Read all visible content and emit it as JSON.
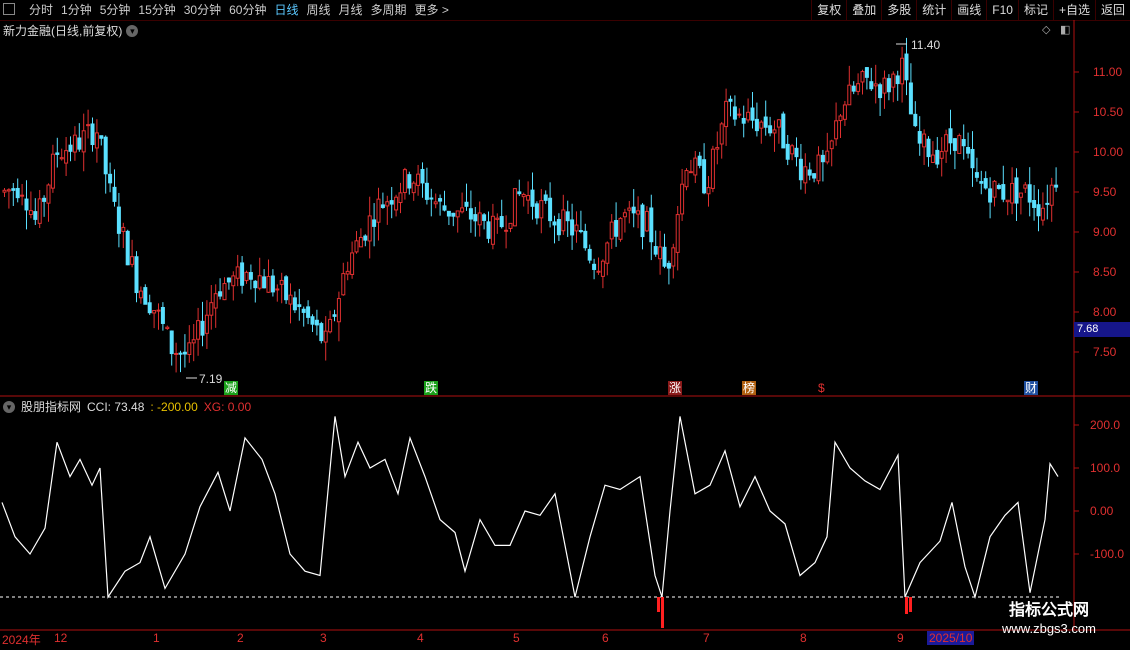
{
  "toolbar": {
    "periods": [
      "分时",
      "1分钟",
      "5分钟",
      "15分钟",
      "30分钟",
      "60分钟",
      "日线",
      "周线",
      "月线",
      "多周期",
      "更多 >"
    ],
    "active_period": "日线",
    "tools": [
      "复权",
      "叠加",
      "多股",
      "统计",
      "画线",
      "F10",
      "标记",
      "+自选",
      "返回"
    ]
  },
  "stock": {
    "title": "新力金融(日线,前复权)"
  },
  "price_axis": {
    "ticks": [
      "11.00",
      "10.50",
      "10.00",
      "9.50",
      "9.00",
      "8.50",
      "8.00",
      "7.50"
    ],
    "current": "7.68"
  },
  "annotations": {
    "high": "11.40",
    "low": "7.19"
  },
  "events": [
    {
      "label": "减",
      "color": "#1aa01a",
      "text": "#fff"
    },
    {
      "label": "跌",
      "color": "#1aa01a",
      "text": "#fff"
    },
    {
      "label": "涨",
      "color": "#8a1a1a",
      "text": "#fff"
    },
    {
      "label": "榜",
      "color": "#b06010",
      "text": "#fff"
    },
    {
      "label": "$",
      "color": "#000",
      "text": "#e03030"
    },
    {
      "label": "财",
      "color": "#2050a0",
      "text": "#fff"
    }
  ],
  "indicator": {
    "name": "股朋指标网",
    "cci": "CCI: 73.48",
    "level": ": -200.00",
    "xg": "XG: 0.00",
    "ticks": [
      "200.0",
      "100.0",
      "0.00",
      "-100.0"
    ]
  },
  "x_axis": {
    "labels": [
      "2024年",
      "12",
      "1",
      "2",
      "3",
      "4",
      "5",
      "6",
      "7",
      "8",
      "9",
      "2025/10"
    ]
  },
  "watermark": {
    "line1": "指标公式网",
    "line2": "www.zbgs3.com"
  },
  "colors": {
    "up": "#e03030",
    "down": "#5be0ff",
    "cci": "#ffffff",
    "signal": "#ff2020",
    "axis": "#e03030"
  }
}
